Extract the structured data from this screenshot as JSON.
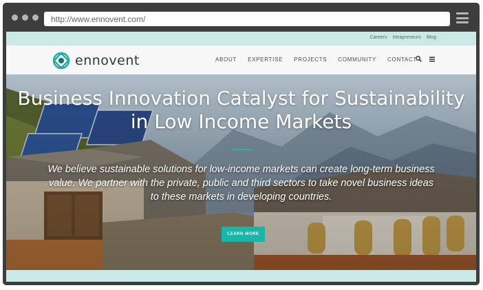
{
  "browser": {
    "url": "http://www.ennovent.com/"
  },
  "utility_nav": {
    "links": [
      "Careers",
      "Intrapreneurs",
      "Blog"
    ]
  },
  "site": {
    "logo_text": "ennovent",
    "nav": [
      "ABOUT",
      "EXPERTISE",
      "PROJECTS",
      "COMMUNITY",
      "CONTACT"
    ],
    "icons": [
      "search-icon",
      "menu-icon"
    ]
  },
  "hero": {
    "title_line1": "Business Innovation Catalyst for Sustainability",
    "title_line2": "in Low Income Markets",
    "description": "We believe sustainable solutions for low-income markets can create long-term business value. We partner with the private, public and third sectors to take novel business ideas to these markets in developing countries.",
    "cta": "LEARN MORE"
  },
  "colors": {
    "accent": "#16b7a8",
    "utility_bar": "#cbe9e6",
    "browser_frame": "#3d3d3d"
  }
}
